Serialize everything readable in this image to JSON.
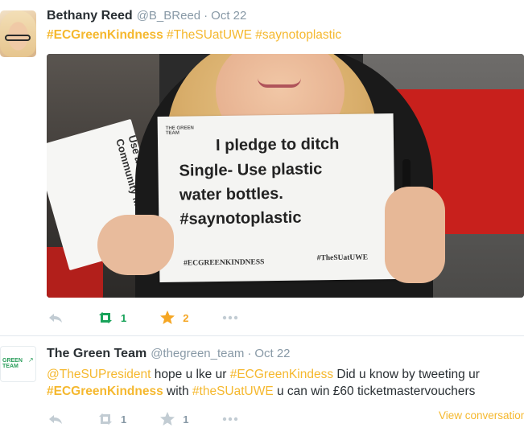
{
  "tweets": [
    {
      "name": "Bethany Reed",
      "handle": "@B_BReed",
      "dot": "·",
      "time": "Oct 22",
      "text_parts": [
        "#ECGreenKindness",
        " ",
        "#TheSUatUWE",
        " ",
        "#saynotoplastic"
      ],
      "image": {
        "sign_lines": [
          "I pledge to ditch",
          "Single- Use plastic",
          "water bottles.",
          "#saynotoplastic"
        ],
        "sign_logo": "THE GREEN TEAM",
        "sign_tag_left": "#ECGREENKINDNESS",
        "sign_tag_right": "#TheSUatUWE",
        "back_paper_text": "Use a mug from the Community Mug Wall"
      },
      "retweets": "1",
      "favorites": "2",
      "retweeted": true,
      "favorited": true
    },
    {
      "name": "The Green Team",
      "handle": "@thegreen_team",
      "dot": "·",
      "time": "Oct 22",
      "line1": [
        "@TheSUPresident",
        " hope u lke ur ",
        "#ECGreenKindess",
        " Did u know by tweeting ur"
      ],
      "line2": [
        "#ECGreenKindness",
        " with ",
        "#theSUatUWE",
        " u can win £60 ticketmastervouchers"
      ],
      "avatar_text": "GREEN TEAM",
      "retweets": "1",
      "favorites": "1",
      "view_conversation": "View conversation"
    }
  ],
  "colors": {
    "hashtag": "#f5b82e",
    "retweet_active": "#19a35a",
    "favorite_active": "#f5a623",
    "muted": "#8899a6"
  }
}
